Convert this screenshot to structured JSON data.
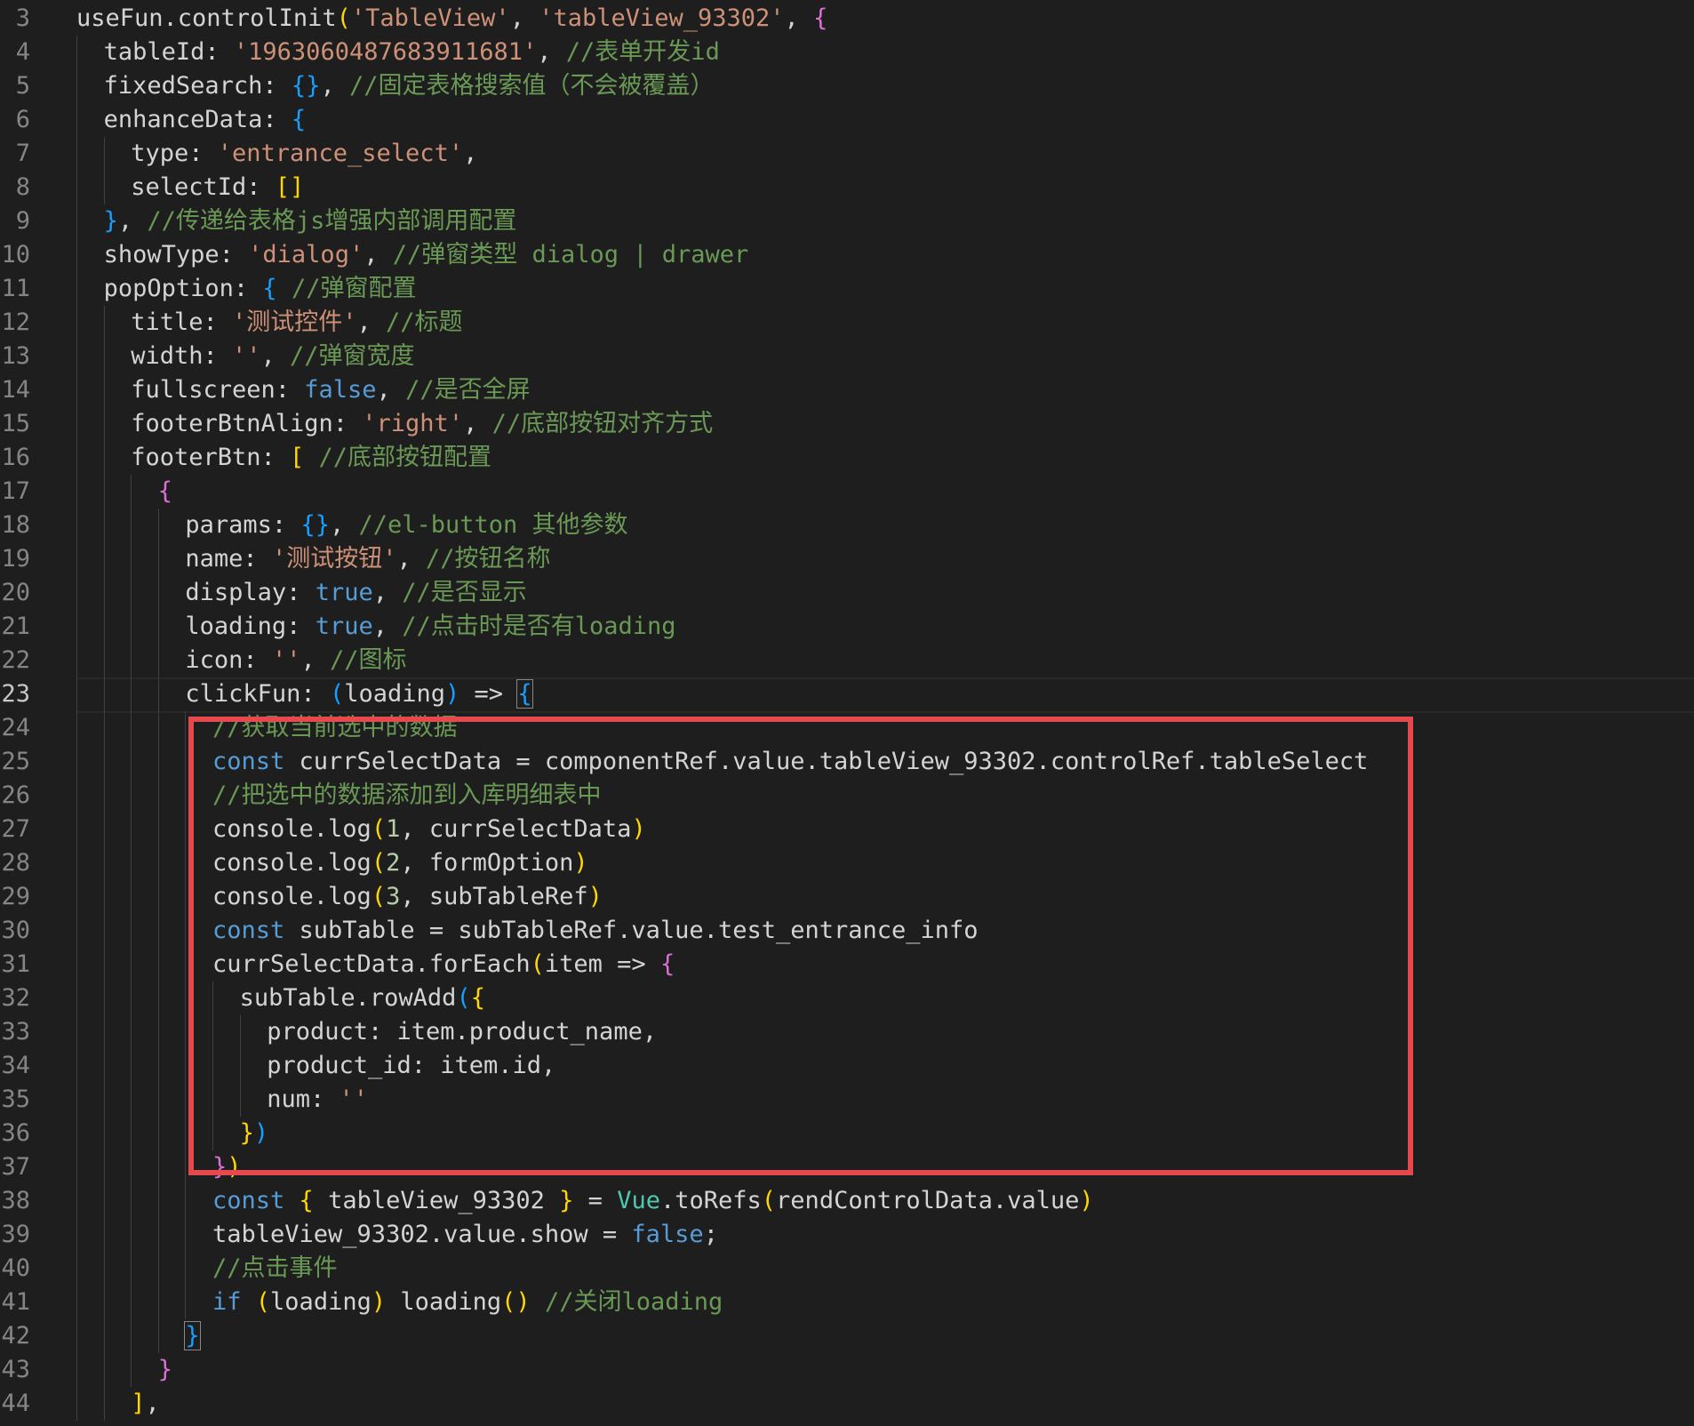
{
  "editor": {
    "active_line": 23,
    "lines": [
      {
        "n": 3,
        "indent": 0,
        "tokens": [
          [
            "plain",
            "useFun.controlInit"
          ],
          [
            "b1",
            "("
          ],
          [
            "str",
            "'TableView'"
          ],
          [
            "plain",
            ", "
          ],
          [
            "str",
            "'tableView_93302'"
          ],
          [
            "plain",
            ", "
          ],
          [
            "b2",
            "{"
          ]
        ]
      },
      {
        "n": 4,
        "indent": 1,
        "tokens": [
          [
            "plain",
            "tableId: "
          ],
          [
            "str",
            "'1963060487683911681'"
          ],
          [
            "plain",
            ", "
          ],
          [
            "com",
            "//表单开发id"
          ]
        ]
      },
      {
        "n": 5,
        "indent": 1,
        "tokens": [
          [
            "plain",
            "fixedSearch: "
          ],
          [
            "b3",
            "{}"
          ],
          [
            "plain",
            ", "
          ],
          [
            "com",
            "//固定表格搜索值（不会被覆盖）"
          ]
        ]
      },
      {
        "n": 6,
        "indent": 1,
        "tokens": [
          [
            "plain",
            "enhanceData: "
          ],
          [
            "b3",
            "{"
          ]
        ]
      },
      {
        "n": 7,
        "indent": 2,
        "tokens": [
          [
            "plain",
            "type: "
          ],
          [
            "str",
            "'entrance_select'"
          ],
          [
            "plain",
            ","
          ]
        ]
      },
      {
        "n": 8,
        "indent": 2,
        "tokens": [
          [
            "plain",
            "selectId: "
          ],
          [
            "b1",
            "[]"
          ]
        ]
      },
      {
        "n": 9,
        "indent": 1,
        "tokens": [
          [
            "b3",
            "}"
          ],
          [
            "plain",
            ", "
          ],
          [
            "com",
            "//传递给表格js增强内部调用配置"
          ]
        ]
      },
      {
        "n": 10,
        "indent": 1,
        "tokens": [
          [
            "plain",
            "showType: "
          ],
          [
            "str",
            "'dialog'"
          ],
          [
            "plain",
            ", "
          ],
          [
            "com",
            "//弹窗类型 dialog | drawer"
          ]
        ]
      },
      {
        "n": 11,
        "indent": 1,
        "tokens": [
          [
            "plain",
            "popOption: "
          ],
          [
            "b3",
            "{"
          ],
          [
            "plain",
            " "
          ],
          [
            "com",
            "//弹窗配置"
          ]
        ]
      },
      {
        "n": 12,
        "indent": 2,
        "tokens": [
          [
            "plain",
            "title: "
          ],
          [
            "str",
            "'测试控件'"
          ],
          [
            "plain",
            ", "
          ],
          [
            "com",
            "//标题"
          ]
        ]
      },
      {
        "n": 13,
        "indent": 2,
        "tokens": [
          [
            "plain",
            "width: "
          ],
          [
            "str",
            "''"
          ],
          [
            "plain",
            ", "
          ],
          [
            "com",
            "//弹窗宽度"
          ]
        ]
      },
      {
        "n": 14,
        "indent": 2,
        "tokens": [
          [
            "plain",
            "fullscreen: "
          ],
          [
            "bool",
            "false"
          ],
          [
            "plain",
            ", "
          ],
          [
            "com",
            "//是否全屏"
          ]
        ]
      },
      {
        "n": 15,
        "indent": 2,
        "tokens": [
          [
            "plain",
            "footerBtnAlign: "
          ],
          [
            "str",
            "'right'"
          ],
          [
            "plain",
            ", "
          ],
          [
            "com",
            "//底部按钮对齐方式"
          ]
        ]
      },
      {
        "n": 16,
        "indent": 2,
        "tokens": [
          [
            "plain",
            "footerBtn: "
          ],
          [
            "b1",
            "["
          ],
          [
            "plain",
            " "
          ],
          [
            "com",
            "//底部按钮配置"
          ]
        ]
      },
      {
        "n": 17,
        "indent": 3,
        "tokens": [
          [
            "b2",
            "{"
          ]
        ]
      },
      {
        "n": 18,
        "indent": 4,
        "tokens": [
          [
            "plain",
            "params: "
          ],
          [
            "b3",
            "{}"
          ],
          [
            "plain",
            ", "
          ],
          [
            "com",
            "//el-button 其他参数"
          ]
        ]
      },
      {
        "n": 19,
        "indent": 4,
        "tokens": [
          [
            "plain",
            "name: "
          ],
          [
            "str",
            "'测试按钮'"
          ],
          [
            "plain",
            ", "
          ],
          [
            "com",
            "//按钮名称"
          ]
        ]
      },
      {
        "n": 20,
        "indent": 4,
        "tokens": [
          [
            "plain",
            "display: "
          ],
          [
            "bool",
            "true"
          ],
          [
            "plain",
            ", "
          ],
          [
            "com",
            "//是否显示"
          ]
        ]
      },
      {
        "n": 21,
        "indent": 4,
        "tokens": [
          [
            "plain",
            "loading: "
          ],
          [
            "bool",
            "true"
          ],
          [
            "plain",
            ", "
          ],
          [
            "com",
            "//点击时是否有loading"
          ]
        ]
      },
      {
        "n": 22,
        "indent": 4,
        "tokens": [
          [
            "plain",
            "icon: "
          ],
          [
            "str",
            "''"
          ],
          [
            "plain",
            ", "
          ],
          [
            "com",
            "//图标"
          ]
        ]
      },
      {
        "n": 23,
        "indent": 4,
        "tokens": [
          [
            "plain",
            "clickFun: "
          ],
          [
            "b3",
            "("
          ],
          [
            "plain",
            "loading"
          ],
          [
            "b3",
            ")"
          ],
          [
            "plain",
            " => "
          ],
          [
            "b3box",
            "{"
          ]
        ]
      },
      {
        "n": 24,
        "indent": 5,
        "tokens": [
          [
            "com",
            "//获取当前选中的数据"
          ]
        ]
      },
      {
        "n": 25,
        "indent": 5,
        "tokens": [
          [
            "kw",
            "const"
          ],
          [
            "plain",
            " currSelectData = componentRef.value.tableView_93302.controlRef.tableSelect"
          ]
        ]
      },
      {
        "n": 26,
        "indent": 5,
        "tokens": [
          [
            "com",
            "//把选中的数据添加到入库明细表中"
          ]
        ]
      },
      {
        "n": 27,
        "indent": 5,
        "tokens": [
          [
            "plain",
            "console.log"
          ],
          [
            "b1",
            "("
          ],
          [
            "num",
            "1"
          ],
          [
            "plain",
            ", currSelectData"
          ],
          [
            "b1",
            ")"
          ]
        ]
      },
      {
        "n": 28,
        "indent": 5,
        "tokens": [
          [
            "plain",
            "console.log"
          ],
          [
            "b1",
            "("
          ],
          [
            "num",
            "2"
          ],
          [
            "plain",
            ", formOption"
          ],
          [
            "b1",
            ")"
          ]
        ]
      },
      {
        "n": 29,
        "indent": 5,
        "tokens": [
          [
            "plain",
            "console.log"
          ],
          [
            "b1",
            "("
          ],
          [
            "num",
            "3"
          ],
          [
            "plain",
            ", subTableRef"
          ],
          [
            "b1",
            ")"
          ]
        ]
      },
      {
        "n": 30,
        "indent": 5,
        "tokens": [
          [
            "kw",
            "const"
          ],
          [
            "plain",
            " subTable = subTableRef.value.test_entrance_info"
          ]
        ]
      },
      {
        "n": 31,
        "indent": 5,
        "tokens": [
          [
            "plain",
            "currSelectData.forEach"
          ],
          [
            "b1",
            "("
          ],
          [
            "plain",
            "item => "
          ],
          [
            "b2",
            "{"
          ]
        ]
      },
      {
        "n": 32,
        "indent": 6,
        "tokens": [
          [
            "plain",
            "subTable.rowAdd"
          ],
          [
            "b3",
            "("
          ],
          [
            "b1",
            "{"
          ]
        ]
      },
      {
        "n": 33,
        "indent": 7,
        "tokens": [
          [
            "plain",
            "product: item.product_name,"
          ]
        ]
      },
      {
        "n": 34,
        "indent": 7,
        "tokens": [
          [
            "plain",
            "product_id: item.id,"
          ]
        ]
      },
      {
        "n": 35,
        "indent": 7,
        "tokens": [
          [
            "plain",
            "num: "
          ],
          [
            "str",
            "''"
          ]
        ]
      },
      {
        "n": 36,
        "indent": 6,
        "tokens": [
          [
            "b1",
            "}"
          ],
          [
            "b3",
            ")"
          ]
        ]
      },
      {
        "n": 37,
        "indent": 5,
        "tokens": [
          [
            "b2",
            "}"
          ],
          [
            "b1",
            ")"
          ]
        ]
      },
      {
        "n": 38,
        "indent": 5,
        "tokens": [
          [
            "kw",
            "const"
          ],
          [
            "plain",
            " "
          ],
          [
            "b1",
            "{"
          ],
          [
            "plain",
            " tableView_93302 "
          ],
          [
            "b1",
            "}"
          ],
          [
            "plain",
            " = "
          ],
          [
            "cls",
            "Vue"
          ],
          [
            "plain",
            ".toRefs"
          ],
          [
            "b1",
            "("
          ],
          [
            "plain",
            "rendControlData.value"
          ],
          [
            "b1",
            ")"
          ]
        ]
      },
      {
        "n": 39,
        "indent": 5,
        "tokens": [
          [
            "plain",
            "tableView_93302.value.show = "
          ],
          [
            "bool",
            "false"
          ],
          [
            "plain",
            ";"
          ]
        ]
      },
      {
        "n": 40,
        "indent": 5,
        "tokens": [
          [
            "com",
            "//点击事件"
          ]
        ]
      },
      {
        "n": 41,
        "indent": 5,
        "tokens": [
          [
            "kw",
            "if"
          ],
          [
            "plain",
            " "
          ],
          [
            "b1",
            "("
          ],
          [
            "plain",
            "loading"
          ],
          [
            "b1",
            ")"
          ],
          [
            "plain",
            " loading"
          ],
          [
            "b1",
            "()"
          ],
          [
            "plain",
            " "
          ],
          [
            "com",
            "//关闭loading"
          ]
        ]
      },
      {
        "n": 42,
        "indent": 4,
        "tokens": [
          [
            "b3box",
            "}"
          ]
        ]
      },
      {
        "n": 43,
        "indent": 3,
        "tokens": [
          [
            "b2",
            "}"
          ]
        ]
      },
      {
        "n": 44,
        "indent": 2,
        "tokens": [
          [
            "b1",
            "]"
          ],
          [
            "plain",
            ","
          ]
        ]
      }
    ]
  },
  "annotation": {
    "color": "#e5484d"
  }
}
